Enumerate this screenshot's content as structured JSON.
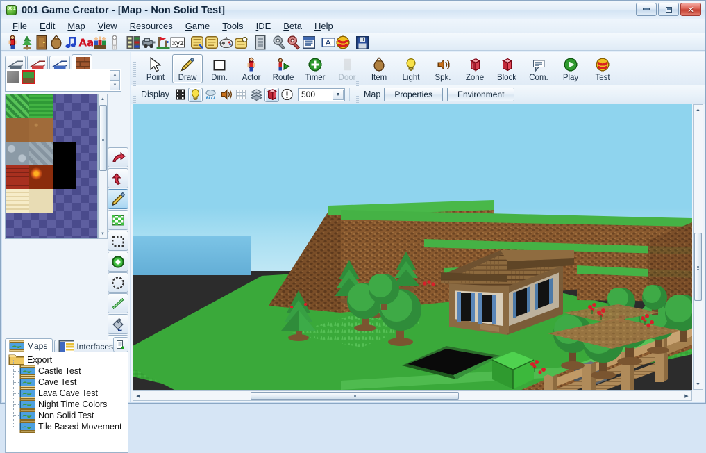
{
  "window": {
    "title": "001 Game Creator - [Map - Non Solid Test]",
    "logo_icon": "001-app-icon",
    "controls": {
      "minimize": "minimize-button",
      "restore": "restore-button",
      "close": "close-button",
      "close_glyph": "✕"
    }
  },
  "menu": {
    "items": [
      {
        "label": "File",
        "accel": "F"
      },
      {
        "label": "Edit",
        "accel": "E"
      },
      {
        "label": "Map",
        "accel": "M"
      },
      {
        "label": "View",
        "accel": "V"
      },
      {
        "label": "Resources",
        "accel": "R"
      },
      {
        "label": "Game",
        "accel": "G"
      },
      {
        "label": "Tools",
        "accel": "T"
      },
      {
        "label": "IDE",
        "accel": "I"
      },
      {
        "label": "Beta",
        "accel": "B"
      },
      {
        "label": "Help",
        "accel": "H"
      }
    ]
  },
  "main_toolbar": {
    "buttons": [
      {
        "icon": "actor-icon",
        "tip": "Actors"
      },
      {
        "icon": "plant-tree-icon",
        "tip": "Objects"
      },
      {
        "icon": "door-icon",
        "tip": "Doors"
      },
      {
        "icon": "item-bag-icon",
        "tip": "Items"
      },
      {
        "icon": "music-note-icon",
        "tip": "Sounds"
      },
      {
        "icon": "font-aa-icon",
        "tip": "Fonts"
      },
      {
        "icon": "party-crowd-icon",
        "tip": "Party"
      },
      {
        "icon": "player-icon",
        "tip": "Player"
      },
      {
        "icon": "list-icon",
        "tip": "Lists"
      },
      {
        "icon": "vehicle-icon",
        "tip": "Vehicles"
      },
      {
        "icon": "flags-icon",
        "tip": "Teams"
      },
      {
        "icon": "variable-xyz-icon",
        "tip": "Variables"
      },
      {
        "icon": "scroll-magic-icon",
        "tip": "Skills"
      },
      {
        "icon": "scroll-icon",
        "tip": "Scripts"
      },
      {
        "icon": "gamepad-icon",
        "tip": "Input"
      },
      {
        "icon": "scroll-star-icon",
        "tip": "Effects"
      },
      {
        "icon": "database-icon",
        "tip": "Database"
      },
      {
        "icon": "gear-grey-icon",
        "tip": "Settings"
      },
      {
        "icon": "gear-red-icon",
        "tip": "Advanced Settings"
      },
      {
        "icon": "text-doc-icon",
        "tip": "Text"
      },
      {
        "icon": "letter-a-box-icon",
        "tip": "Interface"
      },
      {
        "icon": "test-ball-icon",
        "tip": "Test"
      },
      {
        "icon": "save-disk-icon",
        "tip": "Save"
      }
    ]
  },
  "left_panel": {
    "layer_tabs": [
      {
        "icon": "layer-ground-icon",
        "selected": false
      },
      {
        "icon": "layer-middle-icon",
        "selected": false
      },
      {
        "icon": "layer-top-icon",
        "selected": false
      },
      {
        "icon": "layer-wall-icon",
        "selected": true
      }
    ],
    "selected_strip": [
      {
        "icon": "tile-stone-grey",
        "color": "#8c8c8c",
        "active": false
      },
      {
        "icon": "tile-grass-dirt",
        "color": "#3f9a3c",
        "active": true
      }
    ],
    "palette": {
      "transparency_color": "#4a4b8c",
      "rows": [
        [
          {
            "name": "grass-lattice-tile",
            "color": "#3fa93f"
          },
          {
            "name": "grass-tile",
            "color": "#38a838"
          }
        ],
        [
          {
            "name": "dirt-tile",
            "color": "#9a6536"
          },
          {
            "name": "dirt-speckle-tile",
            "color": "#a06b3a"
          }
        ],
        [
          {
            "name": "stone-cobble-tile",
            "color": "#8b9aa6"
          },
          {
            "name": "stone-tile",
            "color": "#93a1ab"
          },
          {
            "name": "black-tile",
            "color": "#000000"
          }
        ],
        [
          {
            "name": "brick-red-tile",
            "color": "#93281e"
          },
          {
            "name": "lava-tile",
            "color": "#d4561a"
          },
          {
            "name": "black-tile",
            "color": "#000000"
          }
        ],
        [
          {
            "name": "sand-wave-tile",
            "color": "#ecdfb9"
          },
          {
            "name": "sand-tile",
            "color": "#e8dcb4"
          }
        ]
      ]
    },
    "vertical_tools": [
      {
        "icon": "redo-arrow-icon",
        "selected": false
      },
      {
        "icon": "undo-arrow-icon",
        "selected": false
      },
      {
        "icon": "pencil-icon",
        "selected": true
      },
      {
        "icon": "fill-pattern-icon",
        "selected": false
      },
      {
        "icon": "select-rect-icon",
        "selected": false
      },
      {
        "icon": "filled-circle-icon",
        "selected": false
      },
      {
        "icon": "hollow-circle-icon",
        "selected": false
      },
      {
        "icon": "line-icon",
        "selected": false
      },
      {
        "icon": "paint-bucket-icon",
        "selected": false
      },
      {
        "icon": "eraser-icon",
        "selected": false
      }
    ],
    "tree_tabs": [
      {
        "label": "Maps",
        "icon": "map-icon",
        "selected": true
      },
      {
        "label": "Interfaces",
        "icon": "interface-icon",
        "selected": false
      }
    ],
    "new_button_icon": "new-document-icon",
    "tree": {
      "root": {
        "label": "Export",
        "icon": "folder-icon"
      },
      "children": [
        {
          "label": "Castle Test",
          "icon": "map-icon"
        },
        {
          "label": "Cave Test",
          "icon": "map-icon"
        },
        {
          "label": "Lava Cave Test",
          "icon": "map-icon"
        },
        {
          "label": "Night Time Colors",
          "icon": "map-icon"
        },
        {
          "label": "Non Solid Test",
          "icon": "map-icon"
        },
        {
          "label": "Tile Based Movement",
          "icon": "map-icon"
        }
      ]
    }
  },
  "tool_toolbar": {
    "buttons": [
      {
        "label": "Point",
        "icon": "cursor-arrow-icon",
        "selected": false,
        "disabled": false
      },
      {
        "label": "Draw",
        "icon": "pencil-icon",
        "selected": true,
        "disabled": false
      },
      {
        "label": "Dim.",
        "icon": "square-outline-icon",
        "selected": false,
        "disabled": false
      },
      {
        "label": "Actor",
        "icon": "actor-icon",
        "selected": false,
        "disabled": false
      },
      {
        "label": "Route",
        "icon": "route-icon",
        "selected": false,
        "disabled": false
      },
      {
        "label": "Timer",
        "icon": "timer-plus-icon",
        "selected": false,
        "disabled": false
      },
      {
        "label": "Door",
        "icon": "door-icon",
        "selected": false,
        "disabled": true
      },
      {
        "label": "Item",
        "icon": "item-bag-icon",
        "selected": false,
        "disabled": false
      },
      {
        "label": "Light",
        "icon": "lightbulb-icon",
        "selected": false,
        "disabled": false
      },
      {
        "label": "Spk.",
        "icon": "speaker-icon",
        "selected": false,
        "disabled": false
      },
      {
        "label": "Zone",
        "icon": "zone-cube-icon",
        "selected": false,
        "disabled": false
      },
      {
        "label": "Block",
        "icon": "block-cube-icon",
        "selected": false,
        "disabled": false
      },
      {
        "label": "Com.",
        "icon": "comment-icon",
        "selected": false,
        "disabled": false
      },
      {
        "label": "Play",
        "icon": "play-circle-icon",
        "selected": false,
        "disabled": false
      },
      {
        "label": "Test",
        "icon": "test-ball-icon",
        "selected": false,
        "disabled": false
      }
    ]
  },
  "display_toolbar": {
    "label": "Display",
    "toggles": [
      {
        "icon": "film-strip-icon",
        "on": false
      },
      {
        "icon": "lightbulb-icon",
        "on": true
      },
      {
        "icon": "weather-rain-icon",
        "on": false
      },
      {
        "icon": "speaker-icon",
        "on": false
      },
      {
        "icon": "grid-icon",
        "on": false
      },
      {
        "icon": "layers-icon",
        "on": false
      },
      {
        "icon": "block-cube-icon",
        "on": true
      },
      {
        "icon": "warning-icon",
        "on": false
      }
    ],
    "zoom_combo": {
      "value": "500",
      "arrow_icon": "chevron-down-icon"
    },
    "map_label": "Map",
    "buttons": [
      {
        "label": "Properties"
      },
      {
        "label": "Environment"
      }
    ]
  },
  "map_view": {
    "name": "Non Solid Test",
    "void_color": "#2c2c2c",
    "sky_color": "#8fd4ee",
    "sea_color": "#6fbbe0",
    "grass_color": "#3aa93a",
    "dirt_color": "#8a5a2f",
    "scrollbars": {
      "vertical": {
        "up_icon": "chevron-up-icon",
        "down_icon": "chevron-down-icon"
      },
      "horizontal": {
        "left_icon": "chevron-left-icon",
        "right_icon": "chevron-right-icon"
      }
    }
  }
}
